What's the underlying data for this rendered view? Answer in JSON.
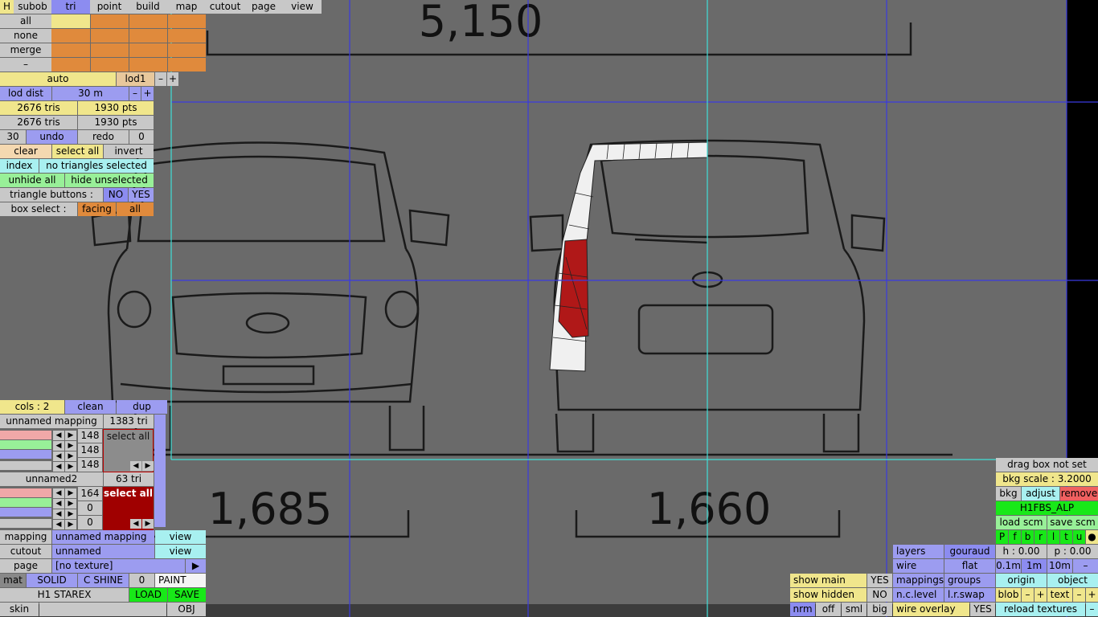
{
  "tabs": [
    "H",
    "subob",
    "tri",
    "point",
    "build",
    "map",
    "cutout",
    "page",
    "view"
  ],
  "left": {
    "all": "all",
    "none": "none",
    "merge": "merge",
    "dash": "–",
    "auto": "auto",
    "lod1": "lod1",
    "minus": "–",
    "plus": "+",
    "lod_dist": "lod dist",
    "lod_dist_val": "30 m",
    "tris1": "2676 tris",
    "pts1": "1930 pts",
    "tris2": "2676 tris",
    "pts2": "1930 pts",
    "undo_n": "30",
    "undo": "undo",
    "redo": "redo",
    "redo_n": "0",
    "clear": "clear",
    "select_all": "select all",
    "invert": "invert",
    "index": "index",
    "no_sel": "no triangles selected",
    "unhide": "unhide all",
    "hide_unsel": "hide unselected",
    "tri_buttons": "triangle buttons :",
    "no": "NO",
    "yes": "YES",
    "box_select": "box select :",
    "facing": "facing",
    "all2": "all"
  },
  "mappings": {
    "cols": "cols : 2",
    "clean": "clean",
    "dup": "dup",
    "m1_name": "unnamed mapping",
    "m1_count": "1383 tri",
    "m1_vals": [
      "148",
      "148",
      "148"
    ],
    "m1_sel": "select all",
    "m2_name": "unnamed2",
    "m2_count": "63 tri",
    "m2_vals": [
      "164",
      "0",
      "0"
    ],
    "m2_sel": "select all",
    "m1_color": "#8c8c8c",
    "m2_color": "#a00000"
  },
  "bottom_left": {
    "mapping": "mapping",
    "mapping_val": "unnamed mapping",
    "view1": "view",
    "cutout": "cutout",
    "cutout_val": "unnamed",
    "view2": "view",
    "page": "page",
    "page_val": "[no texture]",
    "page_arrow": "▶",
    "mat": "mat",
    "solid": "SOLID",
    "cshine": "C SHINE",
    "zero": "0",
    "paint": "PAINT",
    "model": "H1 STAREX",
    "load": "LOAD",
    "save": "SAVE",
    "skin": "skin",
    "obj": "OBJ"
  },
  "blueprint": {
    "dim_top": "5,150",
    "dim_left": "1,685",
    "dim_right": "1,660"
  },
  "right": {
    "drag_box": "drag box not set",
    "bkg_scale": "bkg scale : 3.2000",
    "bkg": "bkg",
    "adjust": "adjust",
    "remove": "remove",
    "texture": "H1FBS_ALP",
    "load_scm": "load scm",
    "save_scm": "save scm",
    "views": [
      "P",
      "f",
      "b",
      "r",
      "l",
      "t",
      "u",
      "●"
    ],
    "layers": "layers",
    "gouraud": "gouraud",
    "h": "h : 0.00",
    "p": "p : 0.00",
    "wire": "wire",
    "flat": "flat",
    "s01": "0.1m",
    "s1": "1m",
    "s10": "10m",
    "sm": "–",
    "show_main": "show main",
    "yes1": "YES",
    "mappings": "mappings",
    "groups": "groups",
    "origin": "origin",
    "object": "object",
    "show_hidden": "show hidden",
    "no1": "NO",
    "nc_level": "n.c.level",
    "lr_swap": "l.r.swap",
    "blob": "blob",
    "bm": "–",
    "bp": "+",
    "text": "text",
    "tm": "–",
    "tp": "+",
    "nrm": "nrm",
    "off": "off",
    "sml": "sml",
    "big": "big",
    "wire_overlay": "wire overlay",
    "yes2": "YES",
    "reload": "reload textures",
    "rm": "–"
  }
}
